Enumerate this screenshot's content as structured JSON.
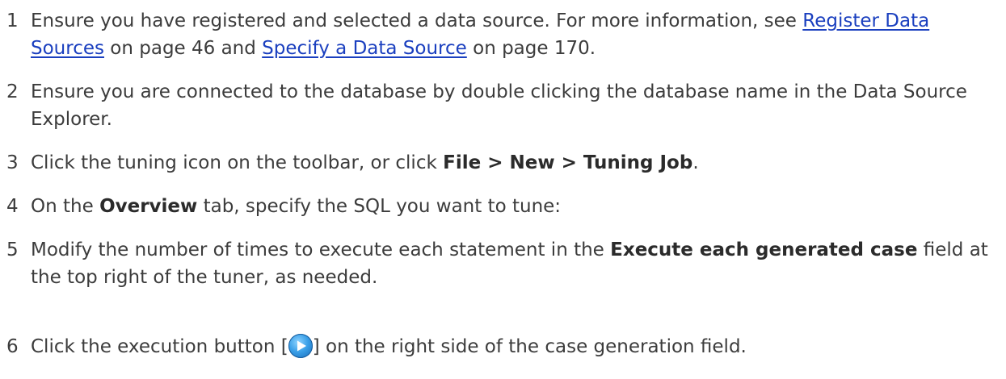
{
  "steps": [
    {
      "number": "1",
      "t1": "Ensure you have registered and selected a data source. For more information, see ",
      "link1": "Register Data Sources",
      "t2": " on page 46 and ",
      "link2": "Specify a Data Source",
      "t3": " on page 170."
    },
    {
      "number": "2",
      "text": "Ensure you are connected to the database by double clicking the database name in the Data Source Explorer."
    },
    {
      "number": "3",
      "t1": "Click the tuning icon on the toolbar, or click ",
      "bold": "File > New > Tuning Job",
      "t2": "."
    },
    {
      "number": "4",
      "t1": "On the ",
      "bold": "Overview",
      "t2": " tab, specify the SQL you want to tune:"
    },
    {
      "number": "5",
      "t1": "Modify the number of times to execute each statement in the ",
      "bold": "Execute each generated case",
      "t2": " field at the top right of the tuner, as needed."
    },
    {
      "number": "6",
      "t1": "Click the execution button [",
      "icon": "play-circle-icon",
      "t2": "] on the right side of the case generation field."
    }
  ]
}
